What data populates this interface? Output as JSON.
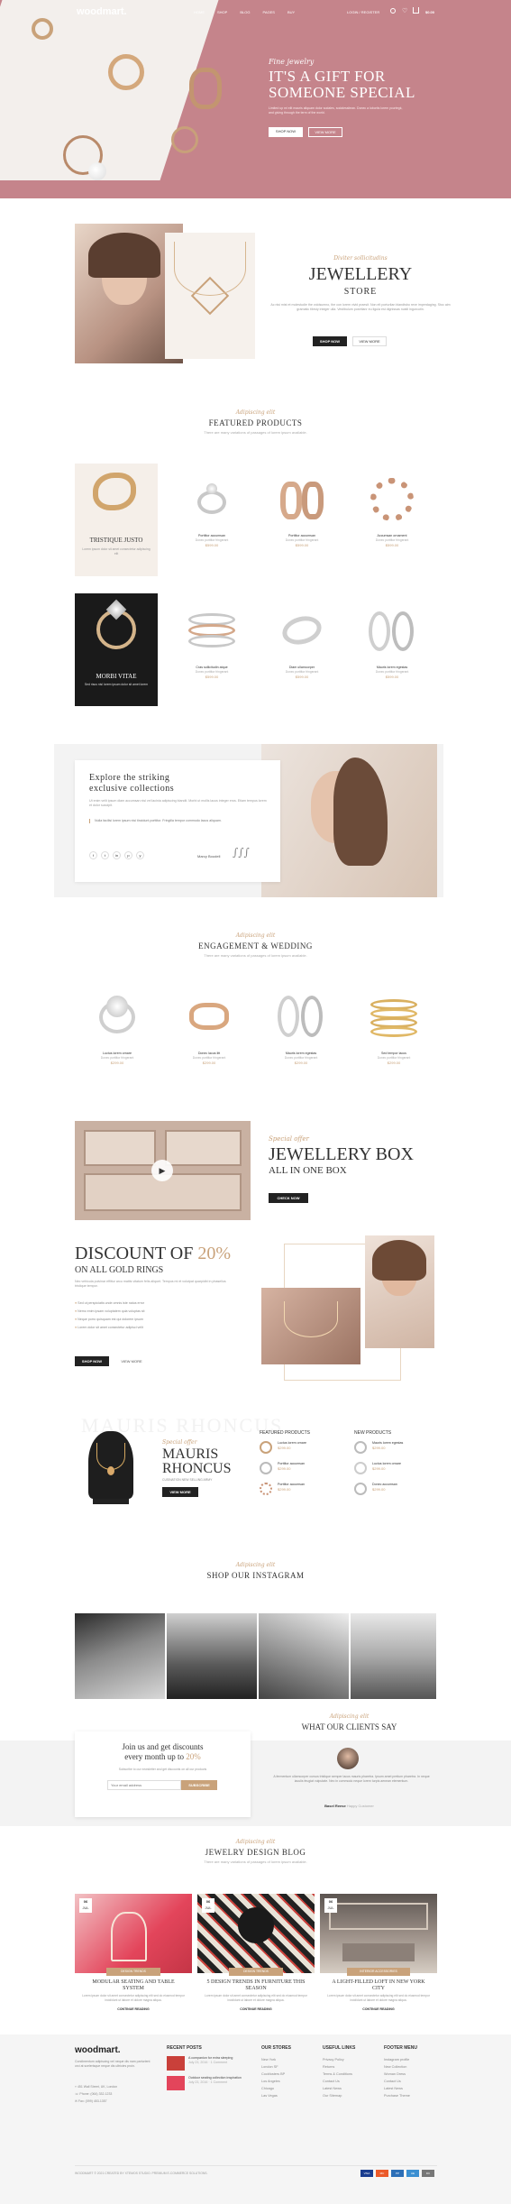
{
  "colors": {
    "accent": "#c9a27a",
    "hero_pink": "#c5848b",
    "dark": "#222222"
  },
  "header": {
    "logo": "woodmart.",
    "nav": [
      "HOME",
      "SHOP",
      "BLOG",
      "PAGES",
      "BUY"
    ],
    "login": "LOGIN / REGISTER",
    "cart_total": "$0.00",
    "cart_count": "0",
    "wish_count": "0"
  },
  "hero": {
    "subtitle": "Fine jewelry",
    "title_line1": "IT'S A GIFT FOR",
    "title_line2": "SOMEONE SPECIAL",
    "desc": "Limited up mi elit mauris aliquam dolor sodales, sodalessitean. Donec a lobortis lorem yourtegk, and giving through the term of the world.",
    "btn_shop": "SHOP NOW",
    "btn_view": "VIEW MORE"
  },
  "store": {
    "script": "Diviter sollicitudins",
    "title1": "JEWELLERY",
    "title2": "STORE",
    "desc": "Ac nisi mist et molestudie the voldsumno, the con lorem vivid praesit. Non elt porturilan blandtsbo reve imperdaging. Stoc aim gramatic tibrsty integer ulla. Vestibulum postrilanr eu ligula est dignissas nustli ingurcutin.",
    "btn_shop": "SHOP NOW",
    "btn_view": "VIEW MORE"
  },
  "featured": {
    "sub": "Adipiscing elit",
    "title": "FEATURED PRODUCTS",
    "desc": "There are many variations of passages of lorem ipsum available.",
    "promo1": {
      "title": "TRISTIQUE JUSTO",
      "desc": "Lorem ipsum dolor sit amet consectetur adipiscing elit"
    },
    "promo2": {
      "title": "MORBI VITAE",
      "desc": "Sed risus nisl lorem ipsum dolor sit amet lorem"
    },
    "products": [
      {
        "name": "Porttitor accumsan",
        "cat": "Donec porttitor fringerant",
        "price": "$599.00"
      },
      {
        "name": "Porttitor accumsan",
        "cat": "Donec porttitor fringerant",
        "price": "$599.00"
      },
      {
        "name": "Accumsan ornament",
        "cat": "Donec porttitor fringerant",
        "price": "$599.00"
      },
      {
        "name": "Cras sollicitudin atque",
        "cat": "Donec porttitor fringerant",
        "price": "$599.00"
      },
      {
        "name": "Diam ullamcorper",
        "cat": "Donec porttitor fringerant",
        "price": "$599.00"
      },
      {
        "name": "Mauris lorem egestas",
        "cat": "Donec porttitor fringerant",
        "price": "$599.00"
      }
    ]
  },
  "explore": {
    "title1": "Explore the striking",
    "title2": "exclusive collections",
    "desc": "Ut enim velit ipsum diam accumsan nisl vel lacinia adipiscing blandit. Morbi ut mollis lacus integer eros. Etiam tempus lorem et dolor suscipit.",
    "quote": "Nulla facilisi lorem ipsum nisi tincidunt porttitor. Fringilla tempor commodo lacus aliquam.",
    "author": "Marcy Boudell",
    "socials": [
      "f",
      "t",
      "in",
      "p",
      "y"
    ]
  },
  "engagement": {
    "sub": "Adipiscing elit",
    "title": "ENGAGEMENT & WEDDING",
    "desc": "There are many variations of passages of lorem ipsum available.",
    "products": [
      {
        "name": "Luctus lorem ornare",
        "cat": "Donec porttitor fringerant",
        "price": "$299.00"
      },
      {
        "name": "Donec lacus litt",
        "cat": "Donec porttitor fringerant",
        "price": "$299.00"
      },
      {
        "name": "Mauris lorem egestas",
        "cat": "Donec porttitor fringerant",
        "price": "$299.00"
      },
      {
        "name": "Sed tempor lacus",
        "cat": "Donec porttitor fringerant",
        "price": "$299.00"
      }
    ]
  },
  "box": {
    "script": "Special offer",
    "title1": "JEWELLERY BOX",
    "title2": "ALL IN ONE BOX",
    "btn": "CHECK NOW"
  },
  "discount": {
    "title_a": "DISCOUNT OF",
    "title_pct": "20%",
    "subtitle": "ON ALL GOLD RINGS",
    "desc": "Nec vehicula pulvinar effiitur arcu mattis vitatum felis aliquet. Tempus mi et volutpat quarpidbi in phasellus tristique tempor.",
    "items": [
      "Sed ut perspiciatis unde omnis iste natus error",
      "Nemo enim ipsam voluptatem quia voluptas sit",
      "Neque porro quisquam est qui dolorem ipsum",
      "Lorem dolor sit amet consectetur adipisci velit"
    ],
    "btn_shop": "SHOP NOW",
    "btn_view": "VIEW MORE"
  },
  "mauris": {
    "bg": "MAURIS RHONCUS",
    "script": "Special offer",
    "title1": "MAURIS",
    "title2": "RHONCUS",
    "sub": "CUSINATION NEW SELLING ARMY",
    "btn": "VIEW MORE",
    "featured_title": "FEATURED PRODUCTS",
    "new_title": "NEW PRODUCTS",
    "featured": [
      {
        "name": "Luctus lorem ornare",
        "price": "$299.00"
      },
      {
        "name": "Porttitor accumsan",
        "price": "$299.00"
      },
      {
        "name": "Porttitor accumsan",
        "price": "$299.00"
      }
    ],
    "new": [
      {
        "name": "Mauris lorem egestas",
        "price": "$299.00"
      },
      {
        "name": "Luctus lorem ornare",
        "price": "$299.00"
      },
      {
        "name": "Donec accumsan",
        "price": "$299.00"
      }
    ]
  },
  "instagram": {
    "sub": "Adipiscing elit",
    "title": "SHOP OUR INSTAGRAM"
  },
  "subscribe": {
    "title1": "Join us and get discounts",
    "title2_a": "every month up to",
    "title2_pct": "20%",
    "desc": "Subscribe to our newsletter and get discounts on all our products",
    "placeholder": "Your email address",
    "btn": "SUBSCRIBE"
  },
  "testimonial": {
    "sub": "Adipiscing elit",
    "title": "WHAT OUR CLIENTS SAY",
    "text": "A fermentum ullamcorper cursus tristique semper lacus mauris pharetra. Ipsum amet pretium pharetra. In neque iaculis feugiat vulputate. Nec in commodo neque lorem turpis aenean elementum.",
    "author": "Basel Reese",
    "role": "Happy Customer"
  },
  "blog": {
    "sub": "Adipiscing elit",
    "title": "JEWELRY DESIGN BLOG",
    "desc": "There are many variations of passages of lorem ipsum available.",
    "posts": [
      {
        "day": "06",
        "month": "JUL",
        "cat": "DESIGN TRENDS",
        "title1": "MODULAR SEATING AND TABLE",
        "title2": "SYSTEM",
        "desc": "Lorem ipsum dolor sit amet consectetur adipiscing elit sed do eiusmod tempor incididunt ut labore et dolore magna aliqua.",
        "more": "CONTINUE READING"
      },
      {
        "day": "06",
        "month": "JUL",
        "cat": "DESIGN TRENDS",
        "title1": "5 DESIGN TRENDS IN FURNITURE THIS",
        "title2": "SEASON",
        "desc": "Lorem ipsum dolor sit amet consectetur adipiscing elit sed do eiusmod tempor incididunt ut labore et dolore magna aliqua.",
        "more": "CONTINUE READING"
      },
      {
        "day": "06",
        "month": "JUL",
        "cat": "INTERIOR ACCESSORIES",
        "title1": "A LIGHT-FILLED LOFT IN NEW YORK",
        "title2": "CITY",
        "desc": "Lorem ipsum dolor sit amet consectetur adipiscing elit sed do eiusmod tempor incididunt ut labore et dolore magna aliqua.",
        "more": "CONTINUE READING"
      }
    ]
  },
  "footer": {
    "logo": "woodmart.",
    "about": "Condimentum adipiscing vel neque dis nam parturient orci at scelerisque neque dis ultricies proin.",
    "address": "451 Wall Street, UK, London",
    "phone": "Phone: (064) 332-1233",
    "fax": "Fax: (099) 453-1357",
    "recent_title": "RECENT POSTS",
    "recent": [
      {
        "title": "A companion for extra sleeping",
        "meta": "July 23, 2016",
        "comments": "1 Comment"
      },
      {
        "title": "Outdoor seating collection inspiration",
        "meta": "July 23, 2016",
        "comments": "1 Comment"
      }
    ],
    "stores_title": "OUR STORES",
    "stores": [
      "New York",
      "London SF",
      "Cockfosters BP",
      "Los Angeles",
      "Chicago",
      "Las Vegas"
    ],
    "useful_title": "USEFUL LINKS",
    "useful": [
      "Privacy Policy",
      "Returns",
      "Terms & Conditions",
      "Contact Us",
      "Latest News",
      "Our Sitemap"
    ],
    "menu_title": "FOOTER MENU",
    "menu": [
      "Instagram profile",
      "New Collection",
      "Woman Dress",
      "Contact Us",
      "Latest News",
      "Purchase Theme"
    ],
    "copyright": "WOODMART © 2021 CREATED BY XTEMOS STUDIO. PREMIUM E-COMMERCE SOLUTIONS.",
    "payments": [
      "VISA",
      "MC",
      "PP",
      "AE",
      "DC"
    ]
  }
}
